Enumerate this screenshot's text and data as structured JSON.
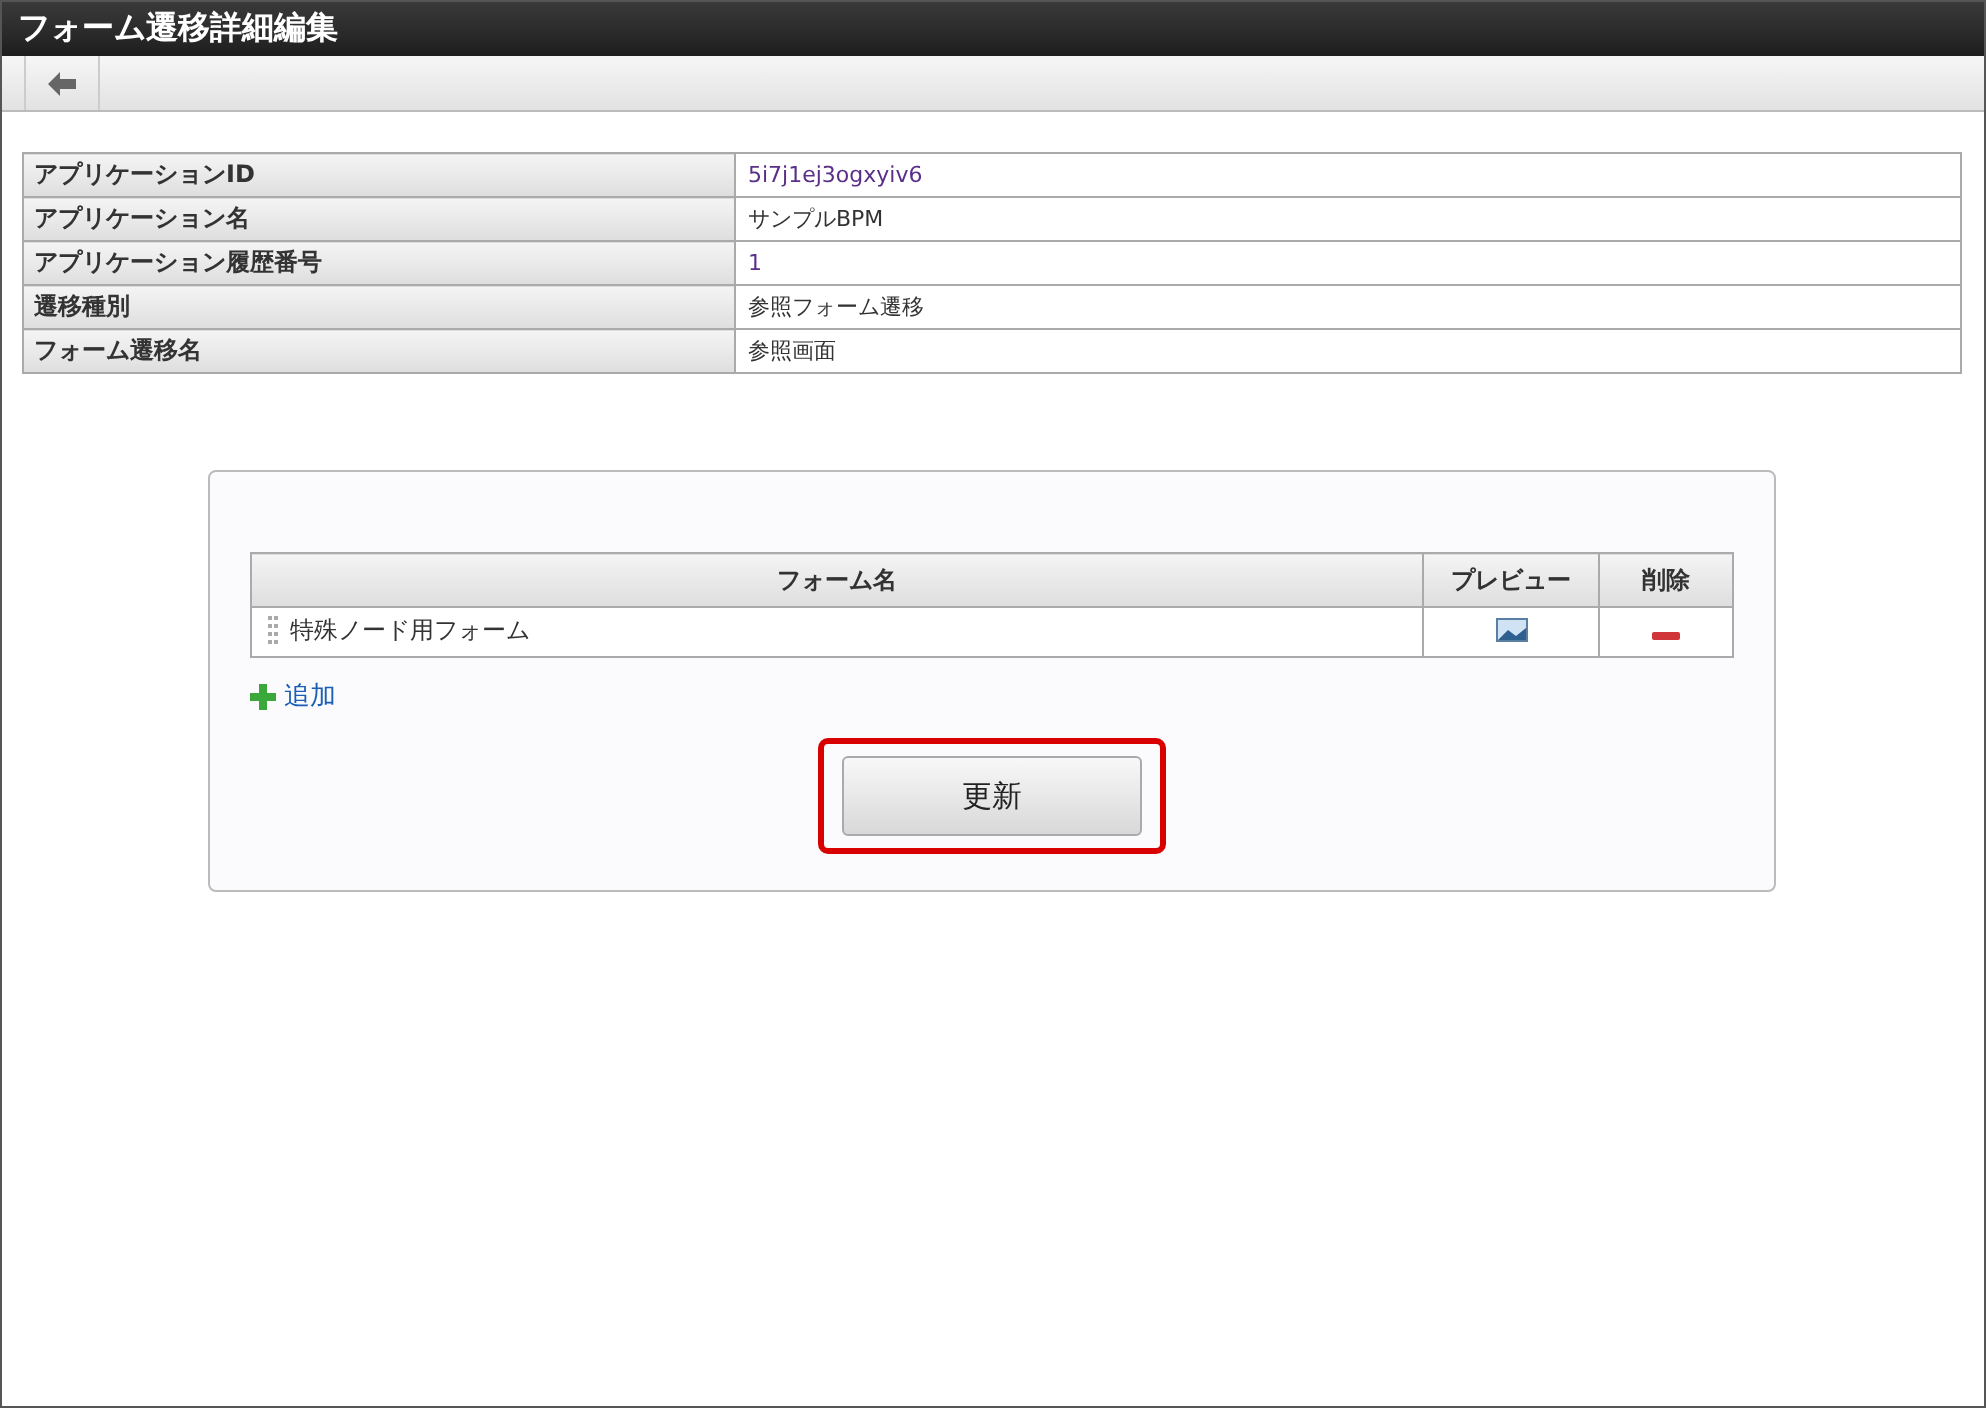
{
  "window": {
    "title": "フォーム遷移詳細編集"
  },
  "info": [
    {
      "label": "アプリケーションID",
      "value": "5i7j1ej3ogxyiv6"
    },
    {
      "label": "アプリケーション名",
      "value": "サンプルBPM"
    },
    {
      "label": "アプリケーション履歴番号",
      "value": "1"
    },
    {
      "label": "遷移種別",
      "value": "参照フォーム遷移"
    },
    {
      "label": "フォーム遷移名",
      "value": "参照画面"
    }
  ],
  "forms_table": {
    "columns": [
      "フォーム名",
      "プレビュー",
      "削除"
    ],
    "rows": [
      {
        "name": "特殊ノード用フォーム"
      }
    ]
  },
  "add_link": "追加",
  "update_button": {
    "label": "更新",
    "highlighted": true
  }
}
